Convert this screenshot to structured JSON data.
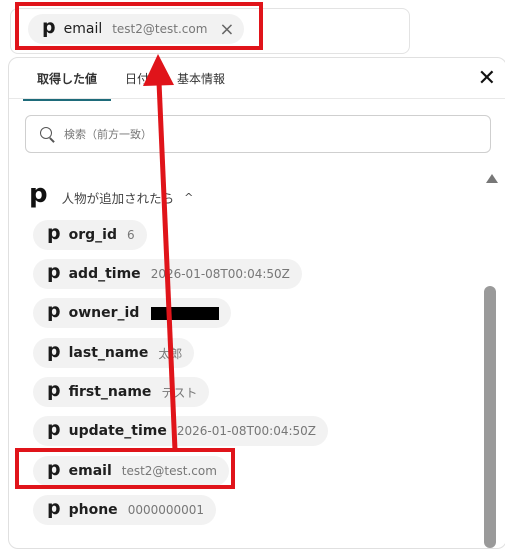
{
  "field": {
    "chip_icon": "p",
    "label": "email",
    "value": "test2@test.com",
    "remove_icon": "×"
  },
  "panel": {
    "tabs": [
      {
        "label": "取得した値",
        "active": true
      },
      {
        "label": "日付"
      },
      {
        "label": "基本情報"
      }
    ],
    "close_icon": "✕",
    "search_placeholder": "検索（前方一致）",
    "group": {
      "logo": "p",
      "title": "人物が追加されたら",
      "chevron": "^"
    },
    "items": [
      {
        "label": "org_id",
        "value": "6"
      },
      {
        "label": "add_time",
        "value": "2026-01-08T00:04:50Z"
      },
      {
        "label": "owner_id",
        "value": ""
      },
      {
        "label": "last_name",
        "value": "太郎"
      },
      {
        "label": "first_name",
        "value": "テスト"
      },
      {
        "label": "update_time",
        "value": "2026-01-08T00:04:50Z"
      },
      {
        "label": "email",
        "value": "test2@test.com"
      },
      {
        "label": "phone",
        "value": "0000000001"
      }
    ]
  },
  "colors": {
    "annotation_red": "#e0141a",
    "tab_accent": "#1e6b7a",
    "chip_bg": "#f2f2f2"
  }
}
